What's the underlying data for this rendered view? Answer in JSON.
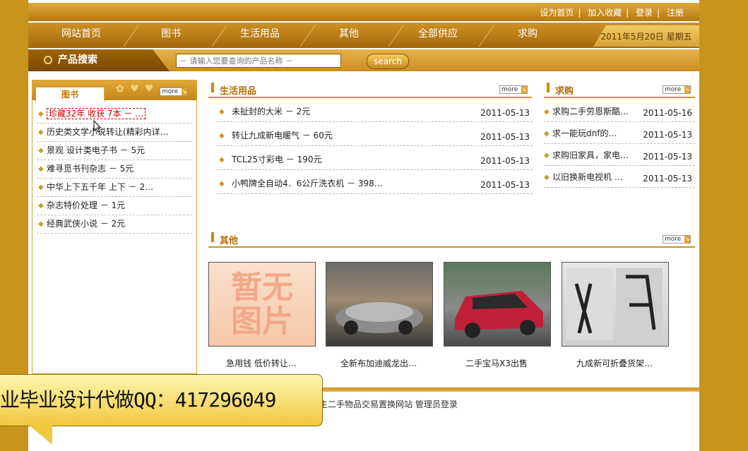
{
  "top_links": [
    "设为首页",
    "加入收藏",
    "登录",
    "注册"
  ],
  "nav": {
    "items": [
      "网站首页",
      "图书",
      "生活用品",
      "其他",
      "全部供应",
      "求购"
    ],
    "date": "2011年5月20日 星期五"
  },
  "search": {
    "label": "产品搜索",
    "placeholder": "－ 请输入您要查询的产品名称 －",
    "button": "search"
  },
  "more_label": "more",
  "left": {
    "title": "图书",
    "items": [
      "珍藏32年 收获 7本 － …",
      "历史类文学小说转让(精彩内详…",
      "景观 设计类电子书 － 5元",
      "难寻觅书刊杂志 － 5元",
      "中华上下五千年 上下 － 2…",
      "杂志特价处理 － 1元",
      "经典武侠小说 － 2元"
    ]
  },
  "living": {
    "title": "生活用品",
    "rows": [
      {
        "title": "未扯封的大米 － 2元",
        "date": "2011-05-13"
      },
      {
        "title": "转让九成新电暖气 － 60元",
        "date": "2011-05-13"
      },
      {
        "title": "TCL25寸彩电 － 190元",
        "date": "2011-05-13"
      },
      {
        "title": "小鸭牌全自动4．6公斤洗衣机 － 398…",
        "date": "2011-05-13"
      }
    ]
  },
  "wanted": {
    "title": "求购",
    "rows": [
      {
        "title": "求购二手劳恩斯酷…",
        "date": "2011-05-16"
      },
      {
        "title": "求一能玩dnf的…",
        "date": "2011-05-13"
      },
      {
        "title": "求购旧家具，家电…",
        "date": "2011-05-13"
      },
      {
        "title": "以旧换新电视机 …",
        "date": "2011-05-13"
      }
    ]
  },
  "other": {
    "title": "其他",
    "no_image_text": [
      "暂无",
      "图片"
    ],
    "items": [
      {
        "caption": "急用钱 低价转让…"
      },
      {
        "caption": "全新布加迪威龙出…"
      },
      {
        "caption": "二手宝马X3出售"
      },
      {
        "caption": "九成新可折叠货架…"
      }
    ]
  },
  "footer": {
    "text": "生二手物品交易置换网站 管理员登录"
  },
  "overlay": {
    "text": "业毕业设计代做QQ：417296049"
  }
}
